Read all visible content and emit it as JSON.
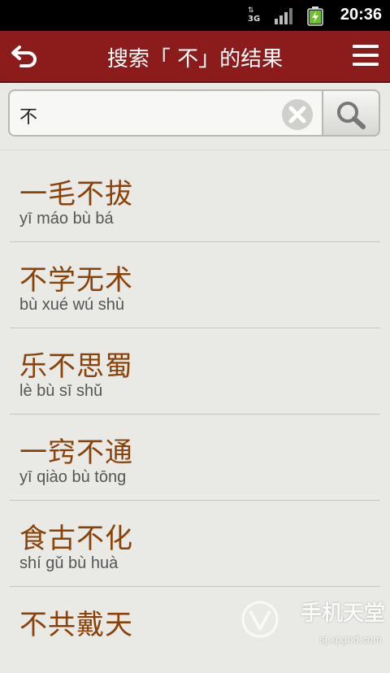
{
  "status_bar": {
    "network": "3G",
    "time": "20:36",
    "icons": [
      "network-3g-icon",
      "signal-icon",
      "battery-charging-icon"
    ]
  },
  "header": {
    "title": "搜索「 不」的结果",
    "back_icon": "back-arrow-icon",
    "menu_icon": "menu-icon",
    "color": "#8c1c1c"
  },
  "search": {
    "value": "不",
    "clear_icon": "clear-icon",
    "search_icon": "search-icon"
  },
  "results": [
    {
      "word": "一毛不拔",
      "pinyin": "yī máo bù bá"
    },
    {
      "word": "不学无术",
      "pinyin": "bù xué wú shù"
    },
    {
      "word": "乐不思蜀",
      "pinyin": "lè bù sī shǔ"
    },
    {
      "word": "一窍不通",
      "pinyin": "yī qiào bù tōng"
    },
    {
      "word": "食古不化",
      "pinyin": "shí gǔ bù huà"
    },
    {
      "word": "不共戴天",
      "pinyin": ""
    }
  ],
  "watermark": {
    "brand": "手机天堂",
    "site": "sj.xpgod.com"
  }
}
